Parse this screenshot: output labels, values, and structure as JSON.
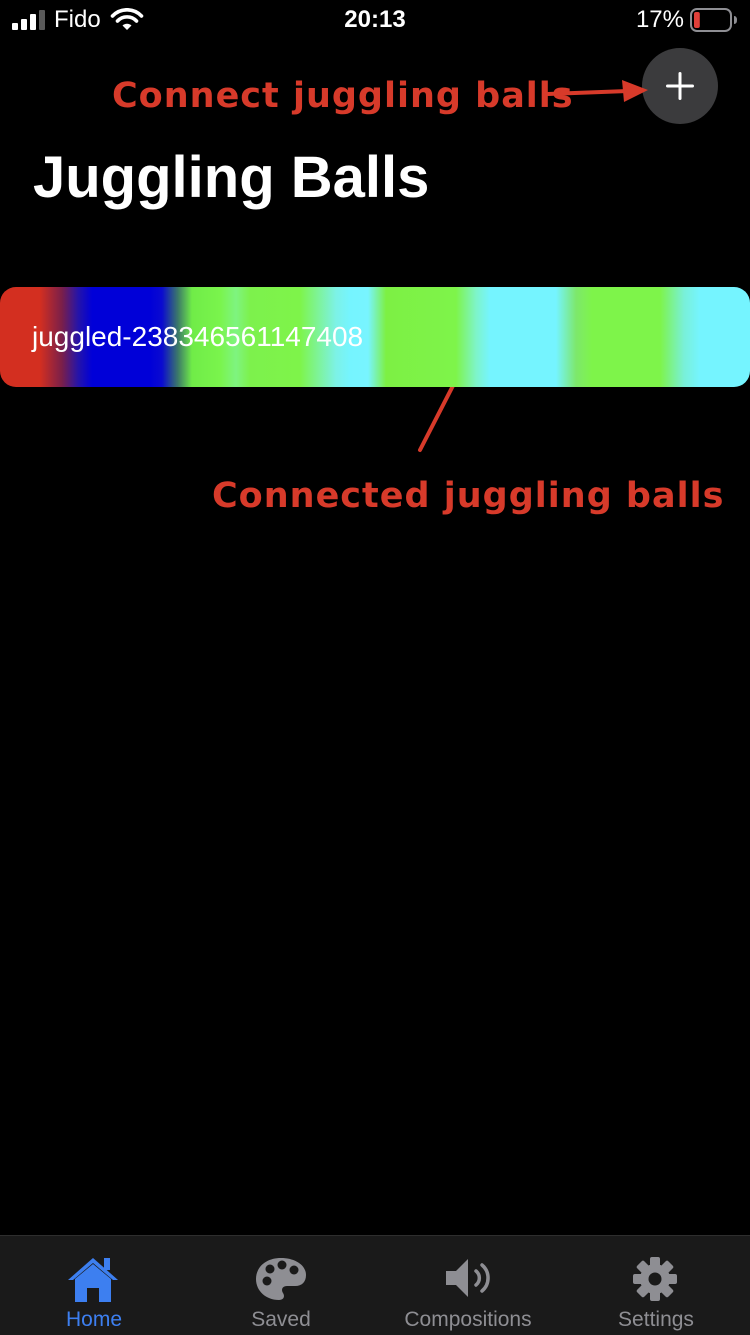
{
  "status_bar": {
    "carrier": "Fido",
    "time": "20:13",
    "battery_percent": "17%",
    "battery_level": 0.17,
    "battery_color": "#e0403a",
    "signal_bars": 3,
    "signal_icon": "cellular-signal-icon",
    "wifi_icon": "wifi-icon",
    "battery_icon": "battery-low-icon"
  },
  "header": {
    "title": "Juggling Balls",
    "add_button": {
      "icon": "plus-icon",
      "color": "#3b3b3d"
    }
  },
  "annotations": {
    "connect": "Connect juggling balls",
    "connected": "Connected juggling balls",
    "color": "#d73a2a"
  },
  "devices": [
    {
      "label": "juggled-238346561147408",
      "colors": [
        "#d32f20",
        "#0000d8",
        "#7ef44a",
        "#75f4ff"
      ]
    }
  ],
  "tab_bar": {
    "active_color": "#3d7ff0",
    "inactive_color": "#8e8e93",
    "tabs": [
      {
        "label": "Home",
        "icon": "home-icon",
        "active": true
      },
      {
        "label": "Saved",
        "icon": "palette-icon",
        "active": false
      },
      {
        "label": "Compositions",
        "icon": "speaker-icon",
        "active": false
      },
      {
        "label": "Settings",
        "icon": "gear-icon",
        "active": false
      }
    ]
  }
}
